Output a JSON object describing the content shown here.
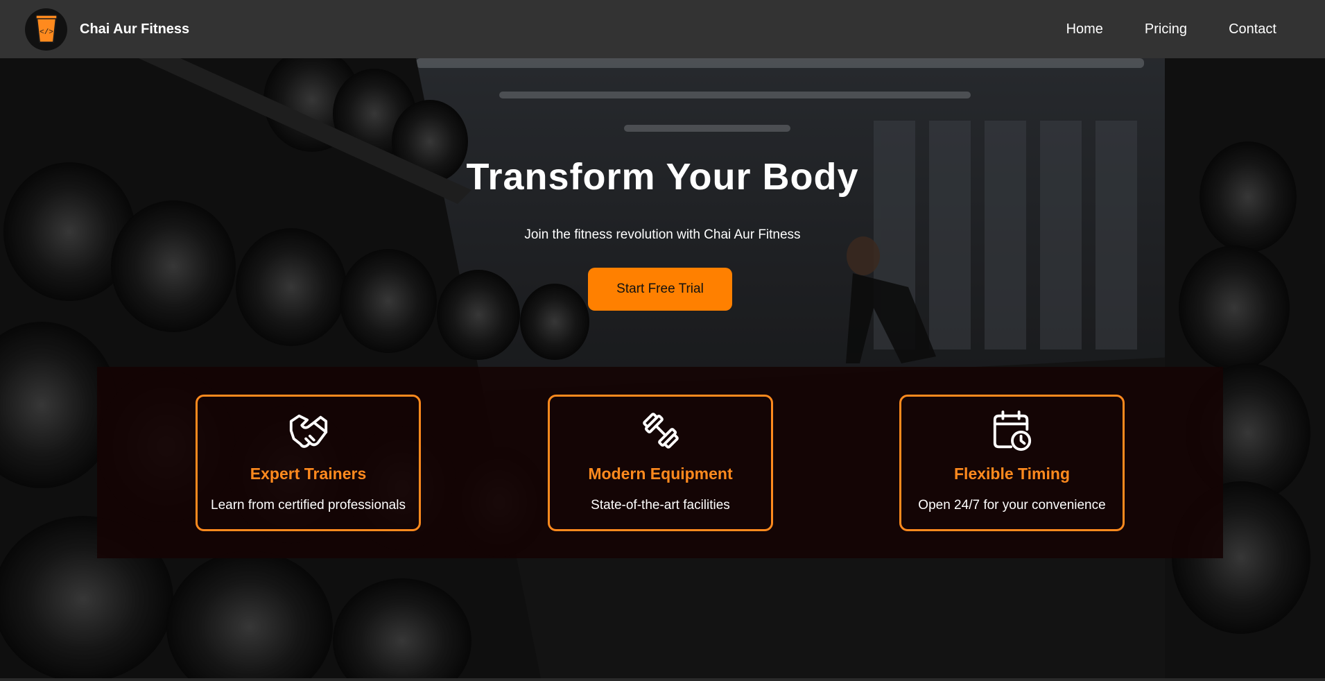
{
  "brand": {
    "name": "Chai Aur Fitness",
    "logo_icon": "chai-cup-code-icon"
  },
  "nav": {
    "items": [
      {
        "label": "Home"
      },
      {
        "label": "Pricing"
      },
      {
        "label": "Contact"
      }
    ]
  },
  "hero": {
    "title": "Transform Your Body",
    "subtitle": "Join the fitness revolution with Chai Aur Fitness",
    "cta_label": "Start Free Trial"
  },
  "features": [
    {
      "icon": "handshake-icon",
      "title": "Expert Trainers",
      "text": "Learn from certified professionals"
    },
    {
      "icon": "dumbbell-icon",
      "title": "Modern Equipment",
      "text": "State-of-the-art facilities"
    },
    {
      "icon": "calendar-clock-icon",
      "title": "Flexible Timing",
      "text": "Open 24/7 for your convenience"
    }
  ],
  "colors": {
    "accent": "#ff8000",
    "navbar_bg": "#333333",
    "feature_title": "#ff8a1e"
  }
}
